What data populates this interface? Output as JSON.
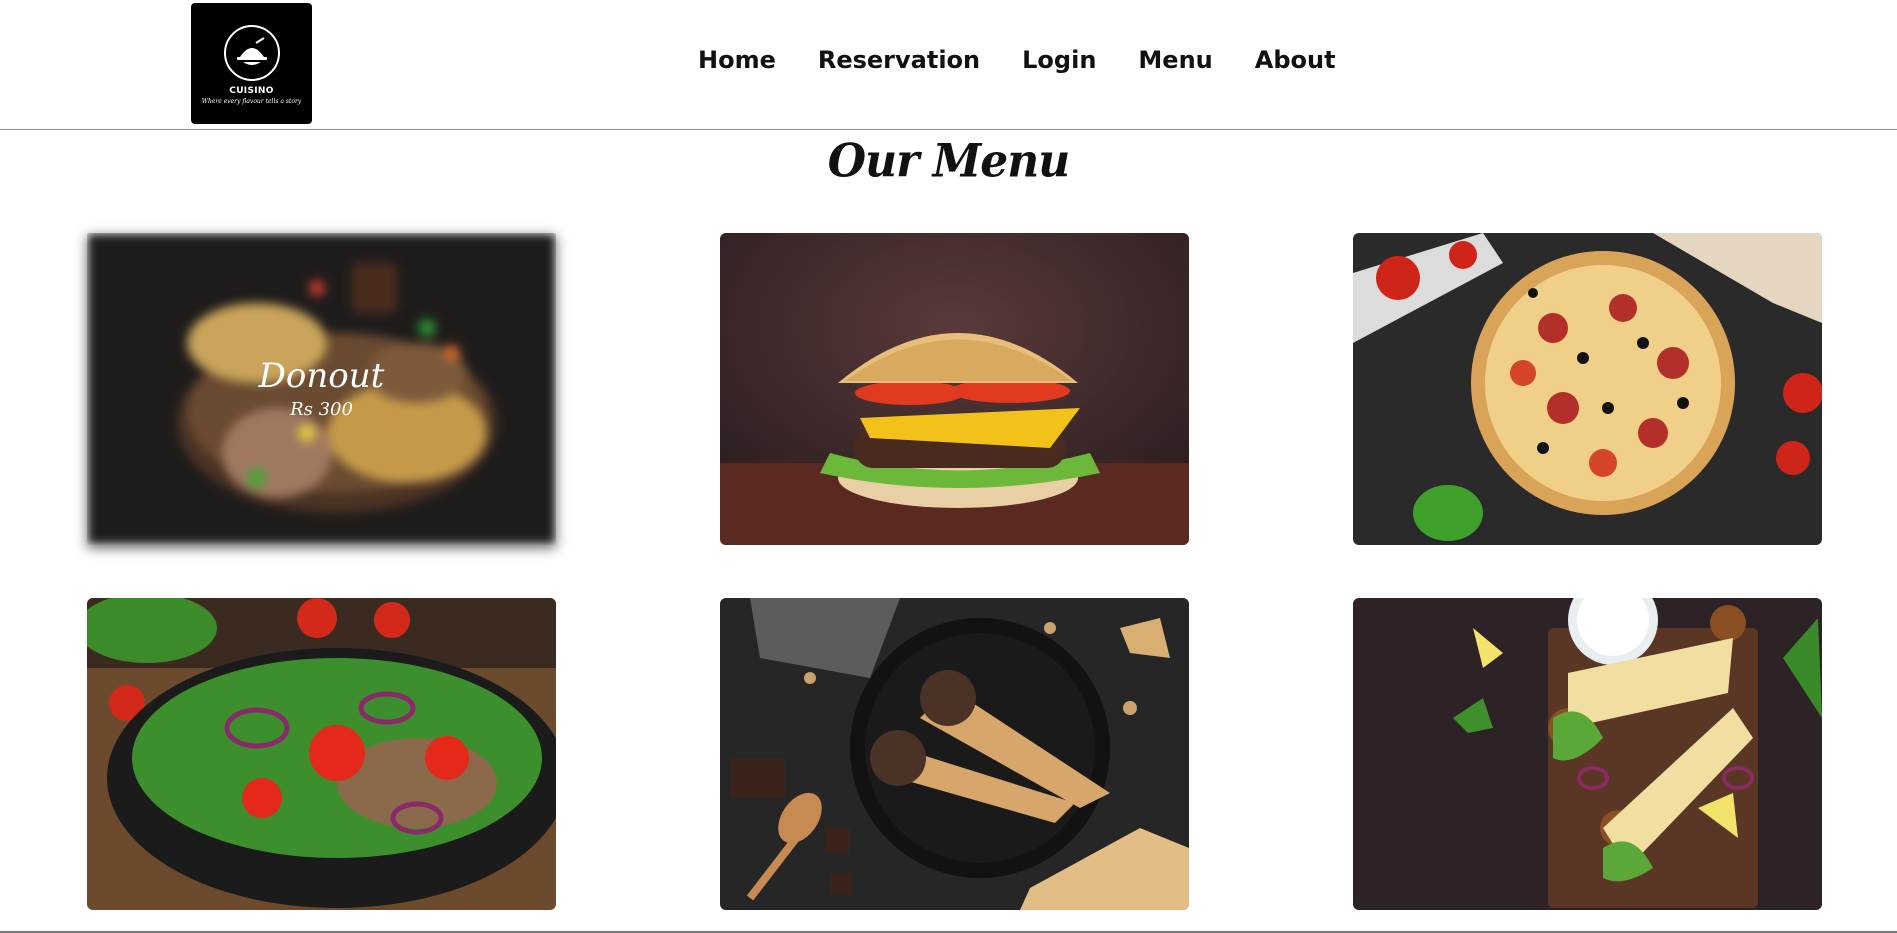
{
  "brand": {
    "name": "CUISINO",
    "tagline": "Where every flavour tells a story",
    "logo_icon": "serving-cloche-icon"
  },
  "nav": {
    "items": [
      "Home",
      "Reservation",
      "Login",
      "Menu",
      "About"
    ]
  },
  "menu": {
    "title": "Our Menu",
    "featured": {
      "name": "Donout",
      "price": "Rs 300"
    },
    "items": [
      {
        "image": "donut-image"
      },
      {
        "image": "burger-image"
      },
      {
        "image": "pizza-image"
      },
      {
        "image": "salad-image"
      },
      {
        "image": "ice-cream-cone-image"
      },
      {
        "image": "wrap-image"
      }
    ]
  },
  "colors": {
    "header_border": "#8f8f8f",
    "logo_bg": "#000000",
    "text": "#111111"
  }
}
